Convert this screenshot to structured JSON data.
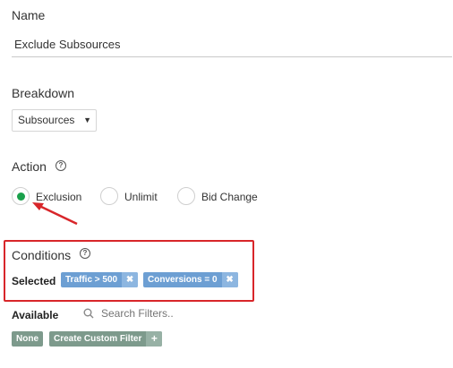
{
  "name": {
    "label": "Name",
    "value": "Exclude Subsources"
  },
  "breakdown": {
    "label": "Breakdown",
    "selected": "Subsources"
  },
  "action": {
    "label": "Action",
    "options": [
      {
        "label": "Exclusion",
        "selected": true
      },
      {
        "label": "Unlimit",
        "selected": false
      },
      {
        "label": "Bid Change",
        "selected": false
      }
    ]
  },
  "conditions": {
    "label": "Conditions",
    "selected_label": "Selected",
    "selected_tags": [
      "Traffic > 500",
      "Conversions = 0"
    ],
    "available_label": "Available",
    "search_placeholder": "Search Filters..",
    "buttons": {
      "none": "None",
      "create": "Create Custom Filter"
    }
  },
  "colors": {
    "radio_selected": "#1aa04b",
    "tag_blue": "#6d9fd3",
    "tag_gray": "#7d9a8c",
    "annotation_red": "#d8262a"
  },
  "icons": {
    "help": "help-circle-icon",
    "search": "search-icon",
    "remove": "close-icon",
    "add": "plus-icon",
    "caret": "caret-down-icon"
  }
}
